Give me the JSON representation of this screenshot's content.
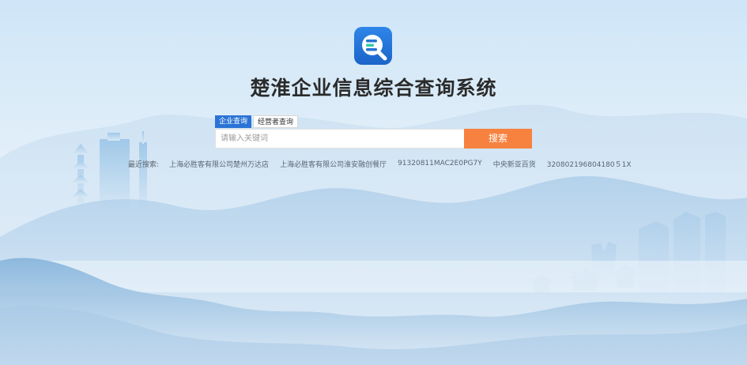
{
  "app": {
    "title": "楚淮企业信息综合查询系统",
    "logo_icon": "search-chat-logo-icon"
  },
  "tabs": [
    {
      "label": "企业查询",
      "active": true
    },
    {
      "label": "经营者查询",
      "active": false
    }
  ],
  "search": {
    "placeholder": "请输入关键词",
    "value": "",
    "button_label": "搜索"
  },
  "recent": {
    "label": "最近搜索:",
    "items": [
      "上海必胜客有限公司楚州万达店",
      "上海必胜客有限公司淮安融创餐厅",
      "91320811MAC2E0PG7Y",
      "中央新亚百货",
      "320802196804180５1X"
    ]
  },
  "colors": {
    "accent_blue": "#2a73d6",
    "search_orange": "#f7823f",
    "title_text": "#2b2b2b",
    "logo_green": "#35c9a6"
  }
}
